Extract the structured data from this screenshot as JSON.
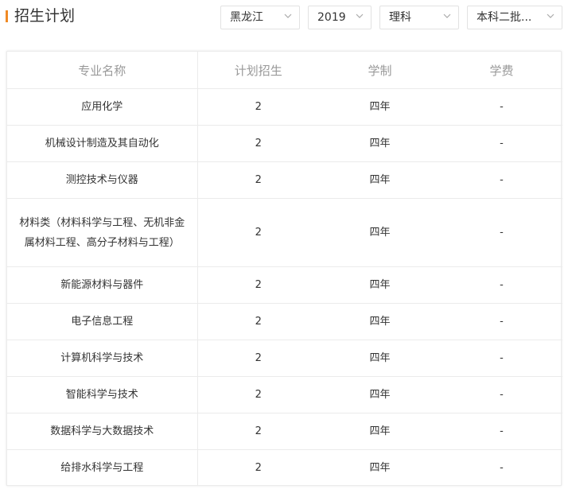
{
  "header": {
    "title": "招生计划",
    "filters": [
      {
        "value": "黑龙江"
      },
      {
        "value": "2019"
      },
      {
        "value": "理科"
      },
      {
        "value": "本科二批..."
      }
    ]
  },
  "table": {
    "columns": [
      "专业名称",
      "计划招生",
      "学制",
      "学费"
    ],
    "rows": [
      {
        "major": "应用化学",
        "plan": "2",
        "duration": "四年",
        "fee": "-"
      },
      {
        "major": "机械设计制造及其自动化",
        "plan": "2",
        "duration": "四年",
        "fee": "-"
      },
      {
        "major": "测控技术与仪器",
        "plan": "2",
        "duration": "四年",
        "fee": "-"
      },
      {
        "major": "材料类（材料科学与工程、无机非金属材料工程、高分子材料与工程）",
        "plan": "2",
        "duration": "四年",
        "fee": "-"
      },
      {
        "major": "新能源材料与器件",
        "plan": "2",
        "duration": "四年",
        "fee": "-"
      },
      {
        "major": "电子信息工程",
        "plan": "2",
        "duration": "四年",
        "fee": "-"
      },
      {
        "major": "计算机科学与技术",
        "plan": "2",
        "duration": "四年",
        "fee": "-"
      },
      {
        "major": "智能科学与技术",
        "plan": "2",
        "duration": "四年",
        "fee": "-"
      },
      {
        "major": "数据科学与大数据技术",
        "plan": "2",
        "duration": "四年",
        "fee": "-"
      },
      {
        "major": "给排水科学与工程",
        "plan": "2",
        "duration": "四年",
        "fee": "-"
      }
    ]
  },
  "colors": {
    "accent": "#f08a24",
    "border": "#ebebeb",
    "header_text": "#999999"
  },
  "icons": {
    "filter_toggle": "chevron-down-icon"
  }
}
